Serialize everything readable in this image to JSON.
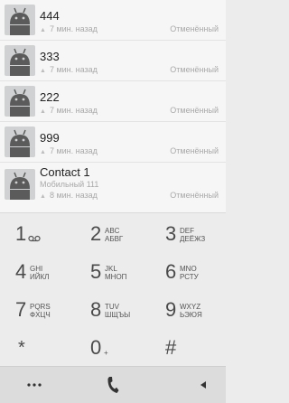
{
  "call_log": [
    {
      "name": "444",
      "time": "7 мин. назад",
      "status": "Отменённый"
    },
    {
      "name": "333",
      "time": "7 мин. назад",
      "status": "Отменённый"
    },
    {
      "name": "222",
      "time": "7 мин. назад",
      "status": "Отменённый"
    },
    {
      "name": "999",
      "time": "7 мин. назад",
      "status": "Отменённый"
    },
    {
      "name": "Contact 1",
      "secondary": "Мобильный 111",
      "time": "8 мин. назад",
      "status": "Отменённый"
    }
  ],
  "dialpad": {
    "keys": [
      {
        "digit": "1",
        "letters_latin": "",
        "letters_cyr": ""
      },
      {
        "digit": "2",
        "letters_latin": "ABC",
        "letters_cyr": "АБВГ"
      },
      {
        "digit": "3",
        "letters_latin": "DEF",
        "letters_cyr": "ДЕЁЖЗ"
      },
      {
        "digit": "4",
        "letters_latin": "GHI",
        "letters_cyr": "ИЙКЛ"
      },
      {
        "digit": "5",
        "letters_latin": "JKL",
        "letters_cyr": "МНОП"
      },
      {
        "digit": "6",
        "letters_latin": "MNO",
        "letters_cyr": "РСТУ"
      },
      {
        "digit": "7",
        "letters_latin": "PQRS",
        "letters_cyr": "ФХЦЧ"
      },
      {
        "digit": "8",
        "letters_latin": "TUV",
        "letters_cyr": "ШЩЪЫ"
      },
      {
        "digit": "9",
        "letters_latin": "WXYZ",
        "letters_cyr": "ЬЭЮЯ"
      },
      {
        "digit": "*",
        "letters_latin": "",
        "letters_cyr": ""
      },
      {
        "digit": "0",
        "letters_latin": "+",
        "letters_cyr": ""
      },
      {
        "digit": "#",
        "letters_latin": "",
        "letters_cyr": ""
      }
    ]
  },
  "bottom_bar": {
    "menu_icon": "more-dots-icon",
    "call_icon": "phone-icon",
    "delete_icon": "backspace-arrow-icon"
  },
  "colors": {
    "list_bg": "#f6f6f6",
    "dialpad_bg": "#ececec",
    "avatar_bg": "#cfd1d2",
    "avatar_fg": "#5b5b5b",
    "muted_text": "#a9a9a9"
  }
}
